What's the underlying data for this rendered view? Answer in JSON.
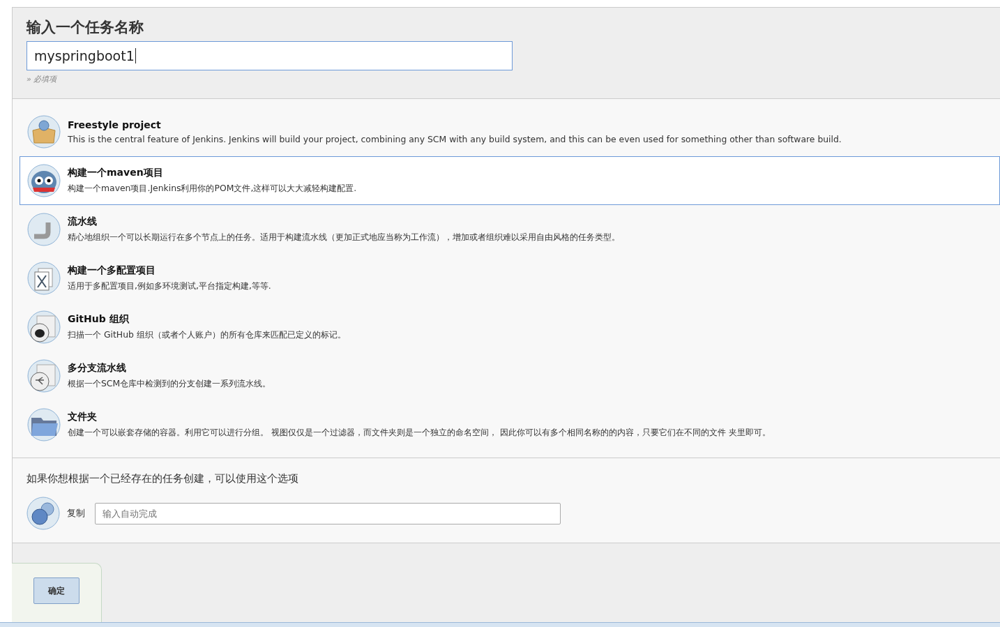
{
  "name_section": {
    "heading": "输入一个任务名称",
    "value": "myspringboot1",
    "hint": "» 必填项"
  },
  "item_types": [
    {
      "kind": "freestyle",
      "title": "Freestyle project",
      "description": "This is the central feature of Jenkins. Jenkins will build your project, combining any SCM with any build system, and this can be even used for something other than software build.",
      "selected": false
    },
    {
      "kind": "maven",
      "title": "构建一个maven项目",
      "description": "构建一个maven项目.Jenkins利用你的POM文件,这样可以大大减轻构建配置.",
      "selected": true
    },
    {
      "kind": "pipeline",
      "title": "流水线",
      "description": "精心地组织一个可以长期运行在多个节点上的任务。适用于构建流水线（更加正式地应当称为工作流），增加或者组织难以采用自由风格的任务类型。",
      "selected": false
    },
    {
      "kind": "matrix",
      "title": "构建一个多配置项目",
      "description": "适用于多配置项目,例如多环境测试,平台指定构建,等等.",
      "selected": false
    },
    {
      "kind": "github",
      "title": "GitHub 组织",
      "description": "扫描一个 GitHub 组织（或者个人账户）的所有仓库来匹配已定义的标记。",
      "selected": false
    },
    {
      "kind": "multibranch",
      "title": "多分支流水线",
      "description": "根据一个SCM仓库中检测到的分支创建一系列流水线。",
      "selected": false
    },
    {
      "kind": "folder",
      "title": "文件夹",
      "description": "创建一个可以嵌套存储的容器。利用它可以进行分组。 视图仅仅是一个过滤器，而文件夹则是一个独立的命名空间， 因此你可以有多个相同名称的的内容，只要它们在不同的文件 夹里即可。",
      "selected": false
    }
  ],
  "copy_section": {
    "text": "如果你想根据一个已经存在的任务创建，可以使用这个选项",
    "label": "复制",
    "placeholder": "输入自动完成"
  },
  "ok_button": "确定"
}
